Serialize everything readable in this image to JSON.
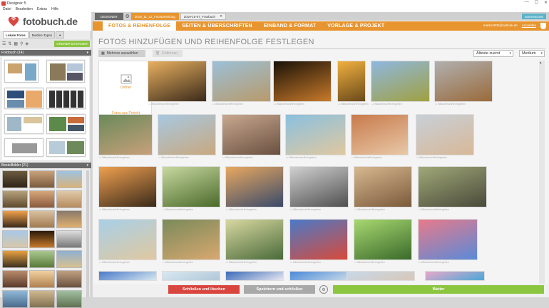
{
  "window": {
    "title": "Designer 5",
    "controls": [
      "—",
      "☐",
      "✕"
    ]
  },
  "menu": [
    "Datei",
    "Bearbeiten",
    "Extras",
    "Hilfe"
  ],
  "logo": {
    "text": "fotobuch.de"
  },
  "left_tabs": [
    "Lokale Fotos",
    "Medien-Typen"
  ],
  "left_toolbar": {
    "green_button": "ORDNER MANAGER"
  },
  "fotobuch_header": "Fotobuch (14)",
  "bestell_header": "Bestellbilder (21)",
  "top_tabs": {
    "designer": "DESIGNER",
    "doc1": "2019_11_12_Fotosammlung",
    "doc2": "2019-10-07_Fotobuch",
    "warenkorb": "WARENKORB"
  },
  "steps": [
    "FOTOS & REIHENFOLGE",
    "SEITEN & ÜBERSCHRIFTEN",
    "EINBAND & FORMAT",
    "VORLAGE & PROJEKT"
  ],
  "user": {
    "email": "marko2005@outlook.de",
    "link": "Anmelden"
  },
  "heading": "FOTOS HINZUFÜGEN UND REIHENFOLGE FESTLEGEN",
  "toolbar": {
    "select_multiple": "Mehrere auswählen",
    "remove": "Entfernen",
    "sort": "Älteste zuerst",
    "size": "Medium"
  },
  "add_tile": {
    "label": "Ordner",
    "footer": "Fotos aus Projekt"
  },
  "caption": "Bildunterschrift eingeben",
  "bottom": {
    "close": "Schließen und löschen",
    "save": "Speichern und schließen",
    "next": "Weiter"
  },
  "colors": {
    "accent": "#e8952f",
    "green": "#8cc63f",
    "red": "#d9453f"
  }
}
